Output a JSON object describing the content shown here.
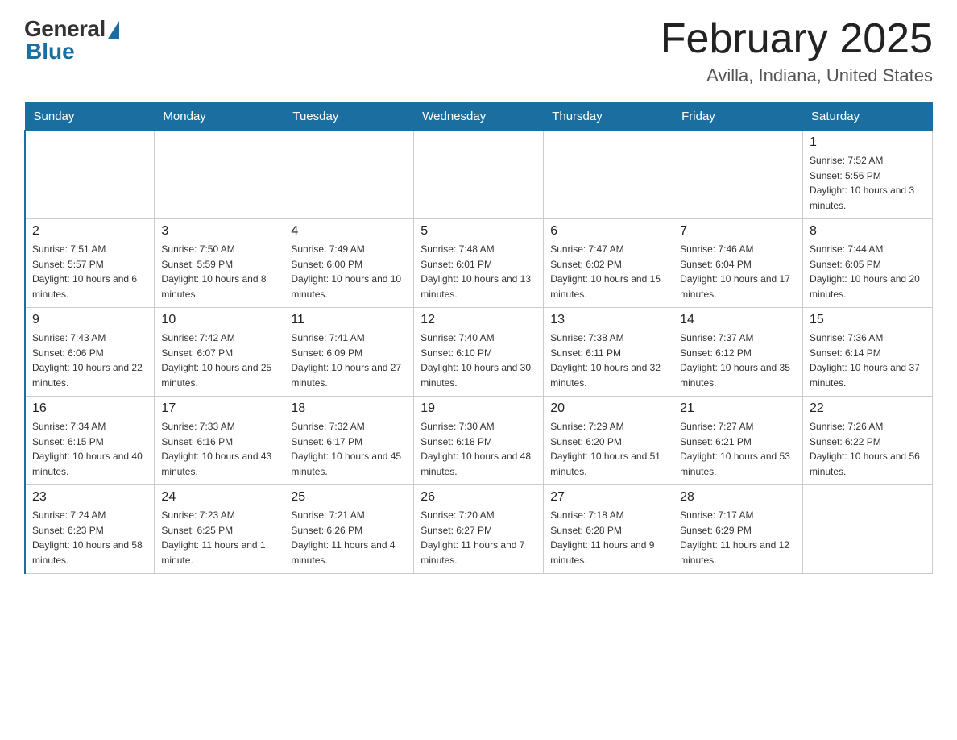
{
  "header": {
    "logo": {
      "general_text": "General",
      "blue_text": "Blue"
    },
    "title": "February 2025",
    "subtitle": "Avilla, Indiana, United States"
  },
  "days_of_week": [
    "Sunday",
    "Monday",
    "Tuesday",
    "Wednesday",
    "Thursday",
    "Friday",
    "Saturday"
  ],
  "weeks": [
    [
      {
        "day": "",
        "info": ""
      },
      {
        "day": "",
        "info": ""
      },
      {
        "day": "",
        "info": ""
      },
      {
        "day": "",
        "info": ""
      },
      {
        "day": "",
        "info": ""
      },
      {
        "day": "",
        "info": ""
      },
      {
        "day": "1",
        "info": "Sunrise: 7:52 AM\nSunset: 5:56 PM\nDaylight: 10 hours and 3 minutes."
      }
    ],
    [
      {
        "day": "2",
        "info": "Sunrise: 7:51 AM\nSunset: 5:57 PM\nDaylight: 10 hours and 6 minutes."
      },
      {
        "day": "3",
        "info": "Sunrise: 7:50 AM\nSunset: 5:59 PM\nDaylight: 10 hours and 8 minutes."
      },
      {
        "day": "4",
        "info": "Sunrise: 7:49 AM\nSunset: 6:00 PM\nDaylight: 10 hours and 10 minutes."
      },
      {
        "day": "5",
        "info": "Sunrise: 7:48 AM\nSunset: 6:01 PM\nDaylight: 10 hours and 13 minutes."
      },
      {
        "day": "6",
        "info": "Sunrise: 7:47 AM\nSunset: 6:02 PM\nDaylight: 10 hours and 15 minutes."
      },
      {
        "day": "7",
        "info": "Sunrise: 7:46 AM\nSunset: 6:04 PM\nDaylight: 10 hours and 17 minutes."
      },
      {
        "day": "8",
        "info": "Sunrise: 7:44 AM\nSunset: 6:05 PM\nDaylight: 10 hours and 20 minutes."
      }
    ],
    [
      {
        "day": "9",
        "info": "Sunrise: 7:43 AM\nSunset: 6:06 PM\nDaylight: 10 hours and 22 minutes."
      },
      {
        "day": "10",
        "info": "Sunrise: 7:42 AM\nSunset: 6:07 PM\nDaylight: 10 hours and 25 minutes."
      },
      {
        "day": "11",
        "info": "Sunrise: 7:41 AM\nSunset: 6:09 PM\nDaylight: 10 hours and 27 minutes."
      },
      {
        "day": "12",
        "info": "Sunrise: 7:40 AM\nSunset: 6:10 PM\nDaylight: 10 hours and 30 minutes."
      },
      {
        "day": "13",
        "info": "Sunrise: 7:38 AM\nSunset: 6:11 PM\nDaylight: 10 hours and 32 minutes."
      },
      {
        "day": "14",
        "info": "Sunrise: 7:37 AM\nSunset: 6:12 PM\nDaylight: 10 hours and 35 minutes."
      },
      {
        "day": "15",
        "info": "Sunrise: 7:36 AM\nSunset: 6:14 PM\nDaylight: 10 hours and 37 minutes."
      }
    ],
    [
      {
        "day": "16",
        "info": "Sunrise: 7:34 AM\nSunset: 6:15 PM\nDaylight: 10 hours and 40 minutes."
      },
      {
        "day": "17",
        "info": "Sunrise: 7:33 AM\nSunset: 6:16 PM\nDaylight: 10 hours and 43 minutes."
      },
      {
        "day": "18",
        "info": "Sunrise: 7:32 AM\nSunset: 6:17 PM\nDaylight: 10 hours and 45 minutes."
      },
      {
        "day": "19",
        "info": "Sunrise: 7:30 AM\nSunset: 6:18 PM\nDaylight: 10 hours and 48 minutes."
      },
      {
        "day": "20",
        "info": "Sunrise: 7:29 AM\nSunset: 6:20 PM\nDaylight: 10 hours and 51 minutes."
      },
      {
        "day": "21",
        "info": "Sunrise: 7:27 AM\nSunset: 6:21 PM\nDaylight: 10 hours and 53 minutes."
      },
      {
        "day": "22",
        "info": "Sunrise: 7:26 AM\nSunset: 6:22 PM\nDaylight: 10 hours and 56 minutes."
      }
    ],
    [
      {
        "day": "23",
        "info": "Sunrise: 7:24 AM\nSunset: 6:23 PM\nDaylight: 10 hours and 58 minutes."
      },
      {
        "day": "24",
        "info": "Sunrise: 7:23 AM\nSunset: 6:25 PM\nDaylight: 11 hours and 1 minute."
      },
      {
        "day": "25",
        "info": "Sunrise: 7:21 AM\nSunset: 6:26 PM\nDaylight: 11 hours and 4 minutes."
      },
      {
        "day": "26",
        "info": "Sunrise: 7:20 AM\nSunset: 6:27 PM\nDaylight: 11 hours and 7 minutes."
      },
      {
        "day": "27",
        "info": "Sunrise: 7:18 AM\nSunset: 6:28 PM\nDaylight: 11 hours and 9 minutes."
      },
      {
        "day": "28",
        "info": "Sunrise: 7:17 AM\nSunset: 6:29 PM\nDaylight: 11 hours and 12 minutes."
      },
      {
        "day": "",
        "info": ""
      }
    ]
  ]
}
